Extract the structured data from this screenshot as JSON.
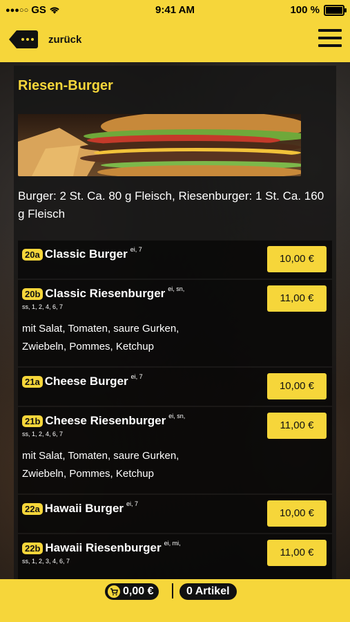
{
  "status_bar": {
    "carrier": "GS",
    "time": "9:41 AM",
    "battery": "100 %"
  },
  "header": {
    "back_label": "zurück"
  },
  "category": {
    "title": "Riesen-Burger",
    "description": "Burger: 2 St. Ca. 80 g Fleisch, Riesenburger: 1 St. Ca. 160 g Fleisch"
  },
  "items": [
    {
      "num": "20a",
      "name": "Classic Burger",
      "allergens": "ei, 7",
      "codes": "",
      "description": "",
      "price": "10,00 €"
    },
    {
      "num": "20b",
      "name": "Classic Riesenburger",
      "allergens": "ei, sn,",
      "codes": "ss, 1, 2, 4, 6, 7",
      "description": "mit Salat, Tomaten, saure Gurken, Zwiebeln, Pommes, Ketchup",
      "price": "11,00 €"
    },
    {
      "num": "21a",
      "name": "Cheese Burger",
      "allergens": "ei, 7",
      "codes": "",
      "description": "",
      "price": "10,00 €"
    },
    {
      "num": "21b",
      "name": "Cheese Riesenburger",
      "allergens": "ei, sn,",
      "codes": "ss, 1, 2, 4, 6, 7",
      "description": "mit Salat, Tomaten, saure Gurken, Zwiebeln, Pommes, Ketchup",
      "price": "11,00 €"
    },
    {
      "num": "22a",
      "name": "Hawaii Burger",
      "allergens": "ei, 7",
      "codes": "",
      "description": "",
      "price": "10,00 €"
    },
    {
      "num": "22b",
      "name": "Hawaii Riesenburger",
      "allergens": "ei, mi,",
      "codes": "ss, 1, 2, 3, 4, 6, 7",
      "description": "",
      "price": "11,00 €"
    }
  ],
  "cart": {
    "total": "0,00 €",
    "articles": "0 Artikel"
  },
  "colors": {
    "accent": "#f6d63a",
    "panel": "#141414"
  }
}
